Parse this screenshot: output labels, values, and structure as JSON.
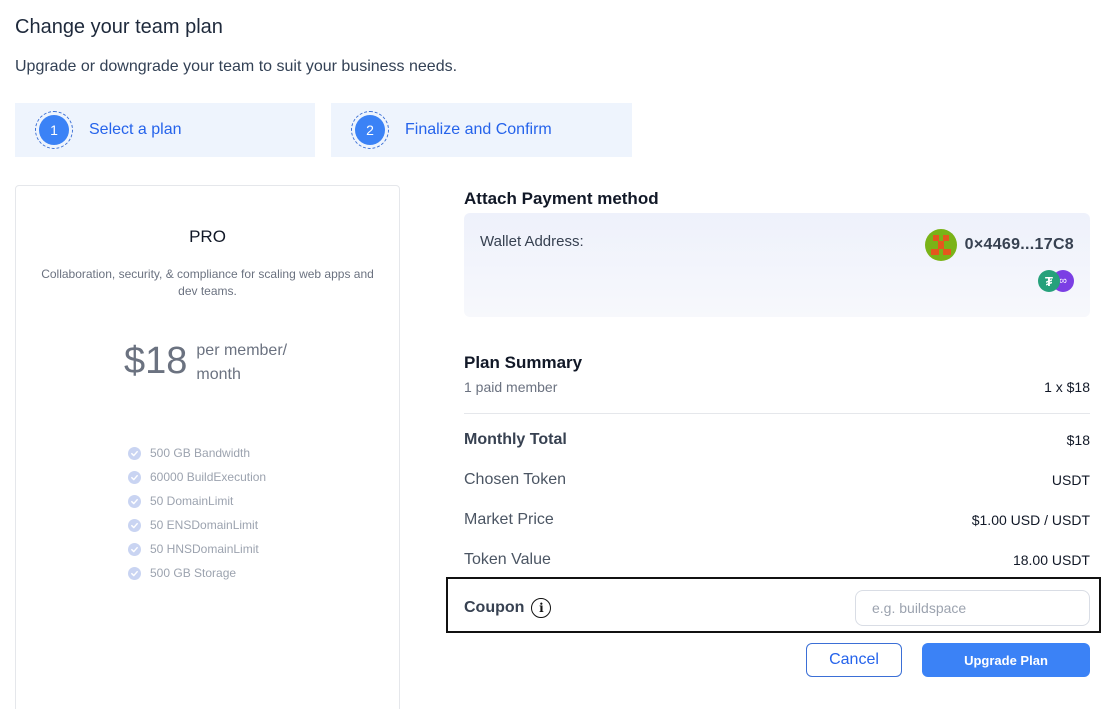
{
  "header": {
    "title": "Change your team plan",
    "subtitle": "Upgrade or downgrade your team to suit your business needs."
  },
  "steps": [
    {
      "number": "1",
      "label": "Select a plan"
    },
    {
      "number": "2",
      "label": "Finalize and Confirm"
    }
  ],
  "plan": {
    "name": "PRO",
    "description": "Collaboration, security, & compliance for scaling web apps and dev teams.",
    "price": "$18",
    "price_unit": "per member/ month",
    "features": [
      "500 GB Bandwidth",
      "60000 BuildExecution",
      "50 DomainLimit",
      "50 ENSDomainLimit",
      "50 HNSDomainLimit",
      "500 GB Storage"
    ]
  },
  "payment": {
    "title": "Attach Payment method",
    "wallet_label": "Wallet Address:",
    "wallet_address": "0×4469...17C8",
    "token_icon_a": "tether-icon",
    "token_icon_b": "polygon-icon"
  },
  "summary": {
    "title": "Plan Summary",
    "members": "1 paid member",
    "quantity": "1 x $18",
    "rows": [
      {
        "label": "Monthly Total",
        "value": "$18"
      },
      {
        "label": "Chosen Token",
        "value": "USDT"
      },
      {
        "label": "Market Price",
        "value": "$1.00 USD / USDT"
      },
      {
        "label": "Token Value",
        "value": "18.00 USDT"
      }
    ]
  },
  "coupon": {
    "label": "Coupon",
    "placeholder": "e.g. buildspace",
    "value": ""
  },
  "actions": {
    "cancel_label": "Cancel",
    "upgrade_label": "Upgrade Plan"
  },
  "colors": {
    "accent": "#3b82f6",
    "step_bg": "#eef4fd",
    "wallet_avatar": "#7ab317",
    "tether": "#26a17b",
    "polygon": "#7b3fe4"
  }
}
